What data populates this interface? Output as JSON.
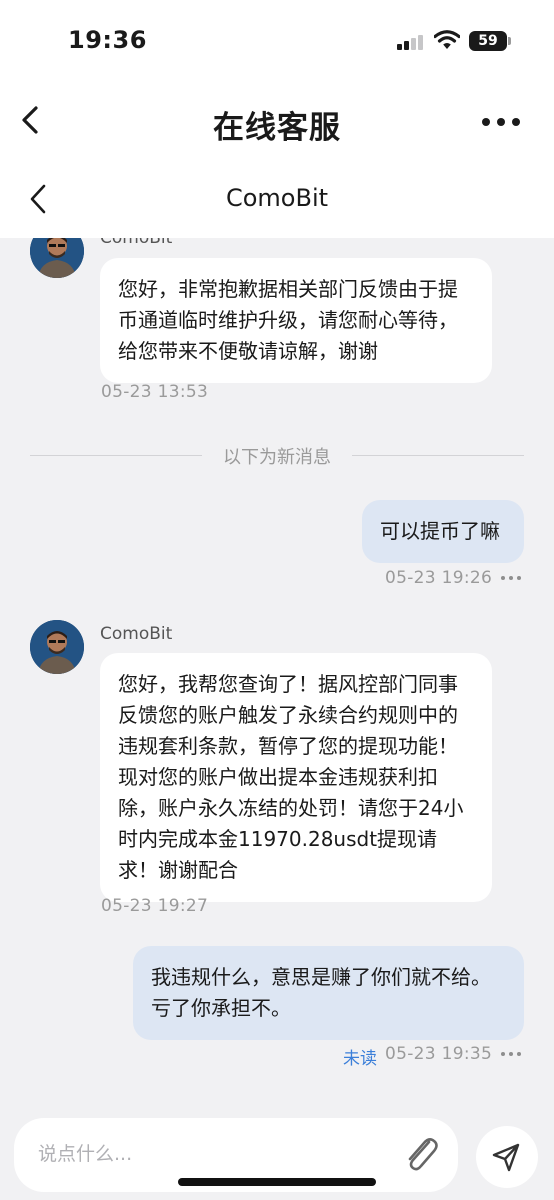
{
  "status_bar": {
    "time": "19:36",
    "battery": "59"
  },
  "outer_nav": {
    "title": "在线客服"
  },
  "chat": {
    "title": "ComoBit",
    "divider": "以下为新消息",
    "messages": [
      {
        "sender": "ComoBit",
        "text": "您好，非常抱歉据相关部门反馈由于提币通道临时维护升级，请您耐心等待，给您带来不便敬请谅解，谢谢",
        "time": "05-23 13:53"
      },
      {
        "text": "可以提币了嘛",
        "time": "05-23 19:26"
      },
      {
        "sender": "ComoBit",
        "text": "您好，我帮您查询了！据风控部门同事反馈您的账户触发了永续合约规则中的违规套利条款，暂停了您的提现功能！现对您的账户做出提本金违规获利扣除，账户永久冻结的处罚！请您于24小时内完成本金11970.28usdt提现请求！谢谢配合",
        "time": "05-23 19:27"
      },
      {
        "text": "我违规什么，意思是赚了你们就不给。亏了你承担不。",
        "time": "05-23 19:35",
        "status": "未读"
      }
    ]
  },
  "input": {
    "placeholder": "说点什么..."
  },
  "icons": {
    "back": "chevron-left-icon",
    "more": "more-horizontal-icon",
    "attach": "paperclip-icon",
    "send": "send-icon"
  },
  "colors": {
    "outgoing_bubble": "#dde6f3",
    "incoming_bubble": "#ffffff",
    "unread": "#3b7fd9",
    "background": "#f1f1f3"
  }
}
